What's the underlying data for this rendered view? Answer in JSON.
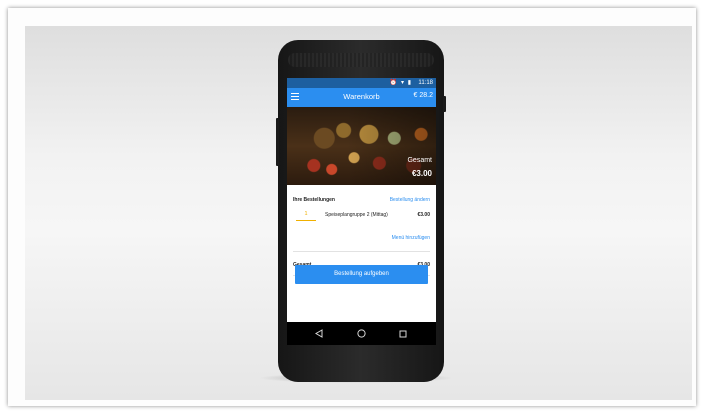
{
  "status_bar": {
    "icons": "⏰ ▾ ▮",
    "time": "11:18"
  },
  "app_bar": {
    "menu_icon": "hamburger-menu-icon",
    "title": "Warenkorb",
    "cart_total": "€ 28.2"
  },
  "hero": {
    "total_label": "Gesamt",
    "total_amount": "€3.00"
  },
  "orders": {
    "title": "Ihre Bestellungen",
    "change_link": "Bestellung ändern",
    "items": [
      {
        "quantity": "1",
        "name": "Speiseplangruppe 2 (Mittag)",
        "price": "€3.00"
      }
    ],
    "add_menu_link": "Menü hinzufügen"
  },
  "summary": {
    "label": "Gesamt",
    "value": "€3.00"
  },
  "checkout": {
    "button_label": "Bestellung aufgeben"
  },
  "nav_bar": {
    "icons": [
      "back-icon",
      "home-icon",
      "recent-apps-icon"
    ]
  },
  "colors": {
    "accent": "#2b8ef0",
    "status_bar": "#1d5fa0",
    "quantity": "#f0b000"
  }
}
